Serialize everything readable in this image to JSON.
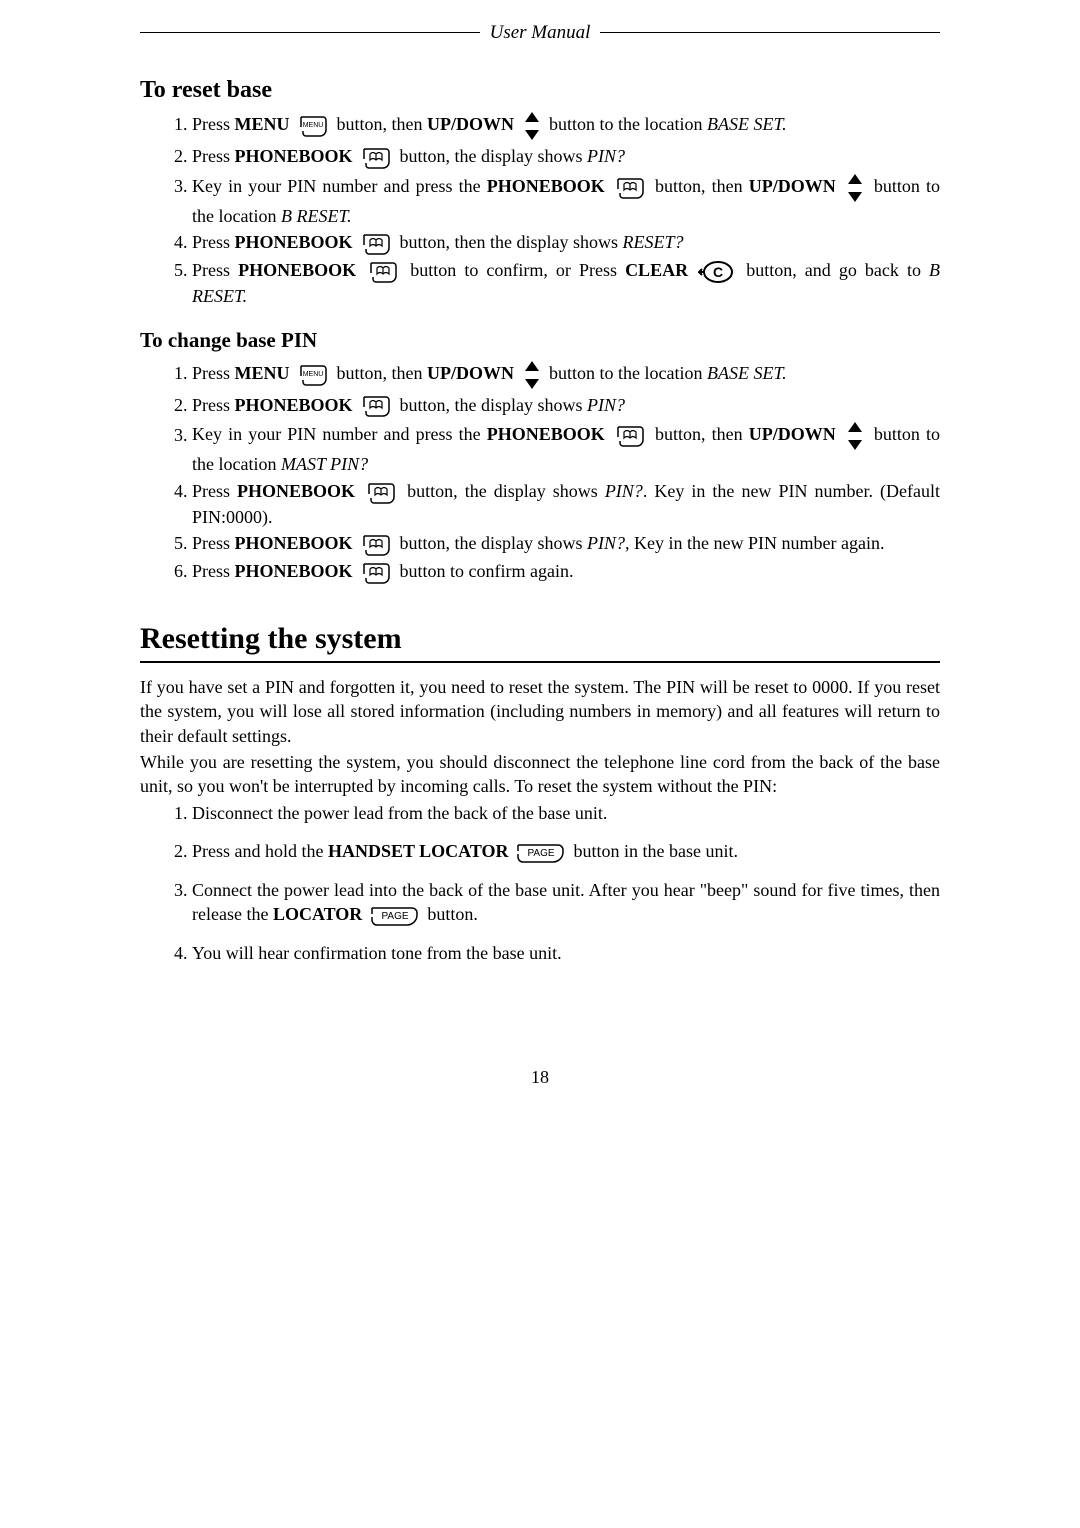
{
  "header_title": "User Manual",
  "s1": {
    "heading": "To reset base",
    "items": [
      {
        "pre": "Press ",
        "b1": "MENU",
        "mid1": " button, then ",
        "b2": "UP/DOWN",
        "mid2": " button to the location ",
        "it": "BASE SET.",
        "tail": ""
      },
      {
        "pre": "Press ",
        "b1": "PHONEBOOK",
        "mid1": " button, the display shows ",
        "it": "PIN?",
        "tail": ""
      },
      {
        "pre": "Key in your PIN number and press the ",
        "b1": "PHONEBOOK",
        "mid1": " button, then ",
        "b2": "UP/DOWN",
        "mid2": " button to the location ",
        "it": "B RESET.",
        "tail": ""
      },
      {
        "pre": "Press ",
        "b1": "PHONEBOOK",
        "mid1": " button, then the display shows ",
        "it": "RESET?",
        "tail": ""
      },
      {
        "pre": "Press ",
        "b1": "PHONEBOOK",
        "mid1": " button to confirm, or Press ",
        "b2": "CLEAR",
        "mid2": " button, and go back to ",
        "it": "B RESET.",
        "tail": ""
      }
    ]
  },
  "s2": {
    "heading": "To change base PIN",
    "items": [
      {
        "pre": "Press ",
        "b1": "MENU",
        "mid1": " button, then ",
        "b2": "UP/DOWN",
        "mid2": " button to the location ",
        "it": "BASE SET.",
        "tail": ""
      },
      {
        "pre": "Press ",
        "b1": "PHONEBOOK",
        "mid1": " button, the display shows ",
        "it": "PIN?",
        "tail": ""
      },
      {
        "pre": "Key in your PIN number and press the ",
        "b1": "PHONEBOOK",
        "mid1": "button, then ",
        "b2": "UP/DOWN",
        "mid2": " button to the location ",
        "it": "MAST PIN?",
        "tail": ""
      },
      {
        "pre": "Press ",
        "b1": "PHONEBOOK",
        "mid1": " button, the display shows ",
        "it": "PIN?",
        "mid2": ". Key in the new PIN number. (Default PIN:0000).",
        "tail": ""
      },
      {
        "pre": "Press ",
        "b1": "PHONEBOOK",
        "mid1": " button, the display shows ",
        "it": "PIN?,",
        "mid2": " Key in the new PIN number again.",
        "tail": ""
      },
      {
        "pre": "Press ",
        "b1": "PHONEBOOK",
        "mid1": "button to confirm again.",
        "tail": ""
      }
    ]
  },
  "reset": {
    "heading": "Resetting the system",
    "para1": "If you have set a PIN and forgotten it, you need to reset the system. The PIN will be reset to 0000. If you reset the system, you will lose all stored information (including numbers in memory) and all features will return to their default settings.",
    "para2": "While you are resetting the system, you should disconnect the telephone line cord from the back of the base unit, so you won't be interrupted by incoming calls. To reset the system without the PIN:",
    "steps": {
      "s1": "Disconnect the power lead from the back of the base unit.",
      "s2_pre": "Press and hold the ",
      "s2_b": "HANDSET LOCATOR",
      "s2_tail": " button in the base unit.",
      "s3_pre": "Connect the power lead into the back of the base unit. After you hear \"beep\" sound for five times, then release the ",
      "s3_b": "LOCATOR",
      "s3_tail": " button.",
      "s4": "You will hear confirmation tone from the base unit."
    }
  },
  "icons": {
    "menu_label": "MENU",
    "page_label": "PAGE"
  },
  "page_number": "18"
}
